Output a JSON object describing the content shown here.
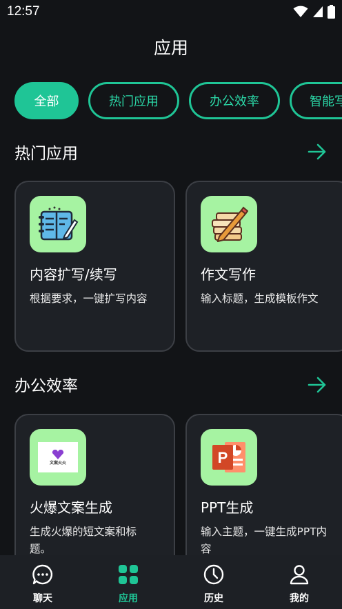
{
  "status_bar": {
    "time": "12:57"
  },
  "page": {
    "title": "应用"
  },
  "tabs": [
    {
      "label": "全部",
      "active": true
    },
    {
      "label": "热门应用",
      "active": false
    },
    {
      "label": "办公效率",
      "active": false
    },
    {
      "label": "智能写",
      "active": false
    }
  ],
  "sections": [
    {
      "title": "热门应用",
      "cards": [
        {
          "name": "内容扩写/续写",
          "desc": "根据要求，一键扩写内容",
          "icon": "notebook-pen-icon"
        },
        {
          "name": "作文写作",
          "desc": "输入标题，生成模板作文",
          "icon": "books-pencil-icon"
        }
      ]
    },
    {
      "title": "办公效率",
      "cards": [
        {
          "name": "火爆文案生成",
          "desc": "生成火爆的短文案和标题。",
          "icon": "copywriting-logo-icon",
          "logo_text": "文案火火"
        },
        {
          "name": "PPT生成",
          "desc": "输入主题，一键生成PPT内容",
          "icon": "powerpoint-icon",
          "logo_text": "P"
        }
      ]
    }
  ],
  "bottom_nav": [
    {
      "label": "聊天",
      "icon": "chat-bubble-icon",
      "active": false
    },
    {
      "label": "应用",
      "icon": "apps-grid-icon",
      "active": true
    },
    {
      "label": "历史",
      "icon": "clock-icon",
      "active": false
    },
    {
      "label": "我的",
      "icon": "person-icon",
      "active": false
    }
  ],
  "colors": {
    "accent": "#1fc596",
    "background": "#121417",
    "card": "#1e2126",
    "icon_bg": "#a6f3a2"
  }
}
